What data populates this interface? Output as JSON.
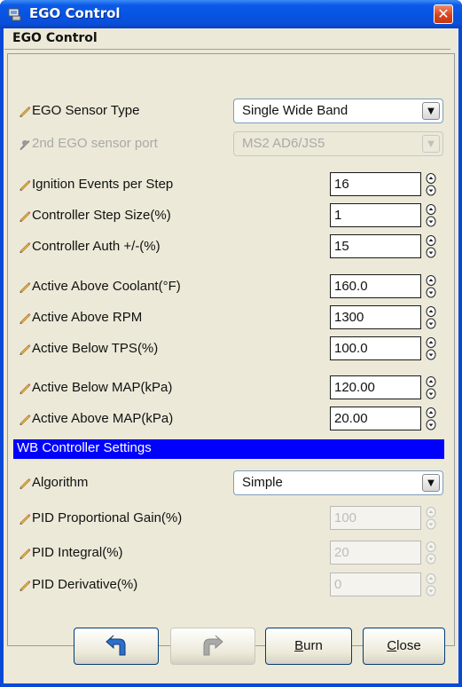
{
  "window": {
    "title": "EGO Control",
    "close_glyph": "✕"
  },
  "panel": {
    "header": "EGO Control"
  },
  "rows": [
    {
      "label": "EGO Sensor Type",
      "type": "combo",
      "value": "Single Wide Band"
    },
    {
      "label": "2nd EGO sensor port",
      "type": "combo",
      "value": "MS2 AD6/JS5",
      "disabled": true
    },
    {
      "label": "Ignition Events per Step",
      "type": "field",
      "value": "16"
    },
    {
      "label": "Controller Step Size(%)",
      "type": "field",
      "value": "1"
    },
    {
      "label": "Controller Auth +/-(%)",
      "type": "field",
      "value": "15"
    },
    {
      "label": "Active Above Coolant(°F)",
      "type": "field",
      "value": "160.0"
    },
    {
      "label": "Active Above RPM",
      "type": "field",
      "value": "1300"
    },
    {
      "label": "Active Below TPS(%)",
      "type": "field",
      "value": "100.0"
    },
    {
      "label": "Active Below MAP(kPa)",
      "type": "field",
      "value": "120.00"
    },
    {
      "label": "Active Above MAP(kPa)",
      "type": "field",
      "value": "20.00"
    }
  ],
  "section": {
    "title": "WB Controller Settings"
  },
  "wb_rows": [
    {
      "label": "Algorithm",
      "type": "combo",
      "value": "Simple"
    },
    {
      "label": "PID Proportional Gain(%)",
      "type": "field",
      "value": "100",
      "disabled": true
    },
    {
      "label": "PID Integral(%)",
      "type": "field",
      "value": "20",
      "disabled": true
    },
    {
      "label": "PID Derivative(%)",
      "type": "field",
      "value": "0",
      "disabled": true
    }
  ],
  "buttons": {
    "undo_icon": "undo-icon",
    "redo_icon": "redo-icon",
    "burn_prefix": "B",
    "burn_rest": "urn",
    "close_prefix": "C",
    "close_rest": "lose"
  },
  "colors": {
    "titlebar": "#0654e3",
    "section_bar": "#0000ff",
    "background": "#ece9d8"
  }
}
